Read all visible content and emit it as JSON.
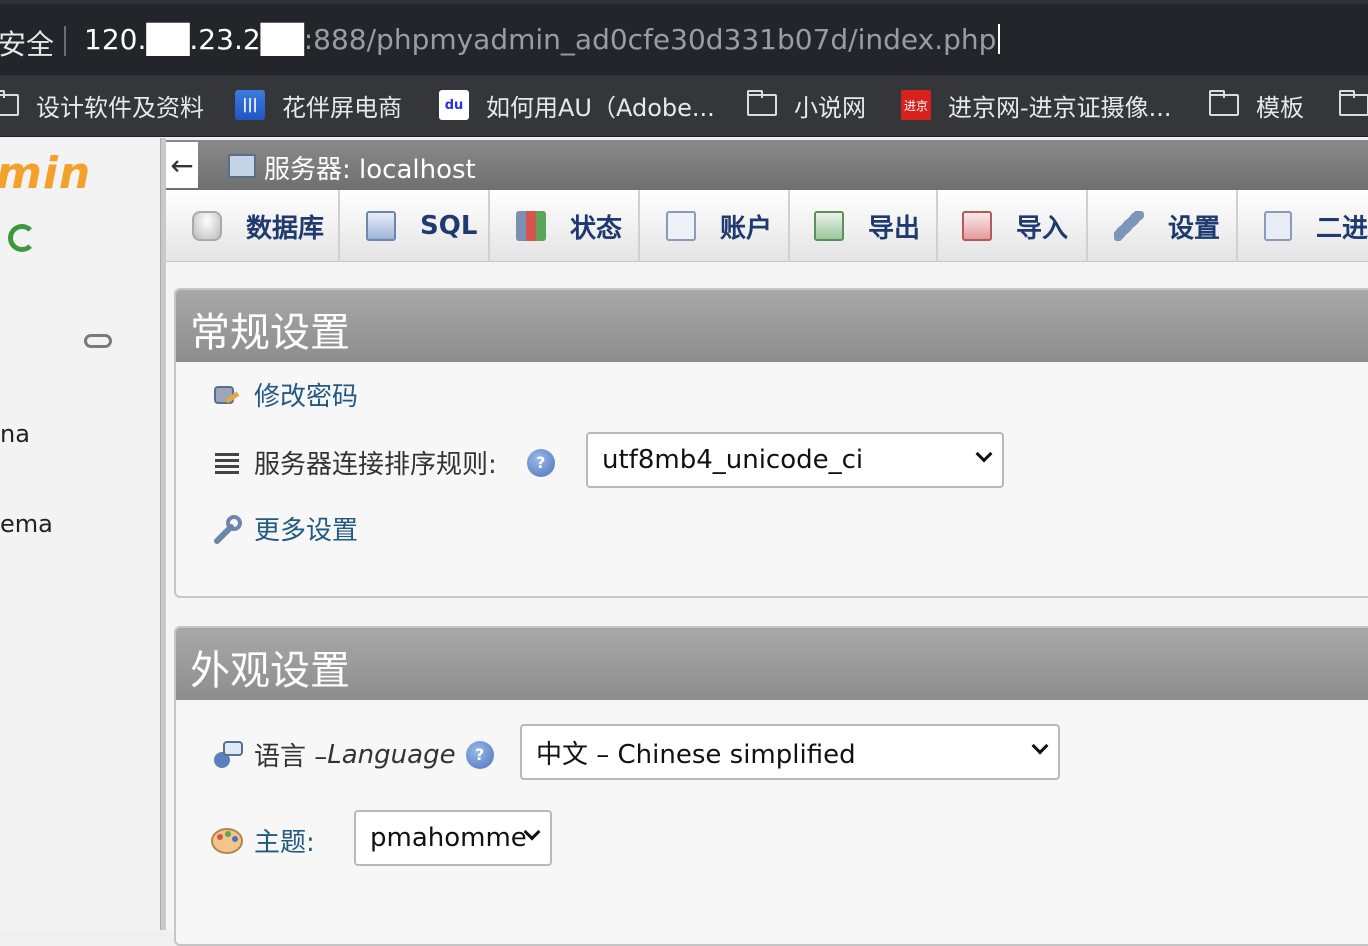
{
  "browser": {
    "security": "安全",
    "url_host": "120.██.23.2██",
    "url_rest": ":888/phpmyadmin_ad0cfe30d331b07d/index.php"
  },
  "bookmarks": [
    {
      "label": "设计软件及资料",
      "icon": "folder-icon"
    },
    {
      "label": "花伴屏电商",
      "icon": "huaban-icon"
    },
    {
      "label": "如何用AU（Adobe...",
      "icon": "baidu-icon"
    },
    {
      "label": "小说网",
      "icon": "folder-icon"
    },
    {
      "label": "进京网-进京证摄像...",
      "icon": "jinjing-icon"
    },
    {
      "label": "模板",
      "icon": "folder-icon"
    }
  ],
  "sidebar": {
    "logo": "min",
    "db_items": [
      "na",
      "ema"
    ]
  },
  "server": {
    "back": "←",
    "title": "服务器: localhost"
  },
  "tabs": [
    {
      "label": "数据库",
      "icon": "database-icon"
    },
    {
      "label": "SQL",
      "icon": "sql-icon"
    },
    {
      "label": "状态",
      "icon": "status-icon"
    },
    {
      "label": "账户",
      "icon": "accounts-icon"
    },
    {
      "label": "导出",
      "icon": "export-icon"
    },
    {
      "label": "导入",
      "icon": "import-icon"
    },
    {
      "label": "设置",
      "icon": "settings-icon"
    },
    {
      "label": "二进",
      "icon": "binlog-icon"
    }
  ],
  "general": {
    "title": "常规设置",
    "change_password": "修改密码",
    "collation_label": "服务器连接排序规则:",
    "collation_value": "utf8mb4_unicode_ci",
    "more_settings": "更多设置"
  },
  "appearance": {
    "title": "外观设置",
    "language_label": "语言 – ",
    "language_italic": "Language",
    "language_value": "中文 – Chinese simplified",
    "theme_label": "主题:",
    "theme_value": "pmahomme"
  },
  "colors": {
    "link": "#235a81",
    "header_gray": "#8d8d8d",
    "logo_orange": "#f4a12b"
  }
}
